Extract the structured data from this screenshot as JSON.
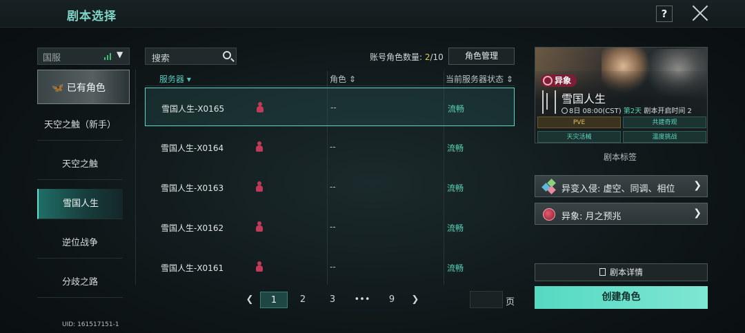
{
  "header": {
    "title": "剧本选择",
    "help_label": "?"
  },
  "sidebar": {
    "region": "国服",
    "owned_label": "已有角色",
    "items": [
      {
        "label": "天空之触（新手）"
      },
      {
        "label": "天空之触"
      },
      {
        "label": "雪国人生"
      },
      {
        "label": "逆位战争"
      },
      {
        "label": "分歧之路"
      }
    ],
    "active_index": 2,
    "uid": "UID: 161517151-1"
  },
  "search": {
    "placeholder": "搜索"
  },
  "account": {
    "label": "账号角色数量: ",
    "current": "2",
    "max": "/10",
    "manage_button": "角色管理"
  },
  "table": {
    "headers": {
      "server": "服务器 ▾",
      "role": "角色 ⇕",
      "status": "当前服务器状态 ⇕"
    },
    "rows": [
      {
        "server": "雪国人生-X0165",
        "role": "--",
        "status": "流畅"
      },
      {
        "server": "雪国人生-X0164",
        "role": "--",
        "status": "流畅"
      },
      {
        "server": "雪国人生-X0163",
        "role": "--",
        "status": "流畅"
      },
      {
        "server": "雪国人生-X0162",
        "role": "--",
        "status": "流畅"
      },
      {
        "server": "雪国人生-X0161",
        "role": "--",
        "status": "流畅"
      }
    ],
    "selected_index": 0
  },
  "pagination": {
    "prev": "❮",
    "pages": [
      "1",
      "2",
      "3",
      "•••",
      "9"
    ],
    "next": "❯",
    "active": "1",
    "page_suffix": "页"
  },
  "scenario": {
    "badge": "异象",
    "name": "雪国人生",
    "time": "8日 08:00(CST)",
    "day": "第2天",
    "open_text": "剧本开启时间 2",
    "tags": [
      "PVE",
      "共建奇观",
      "天灾活械",
      "温度挑战"
    ],
    "tags_title": "剧本标签",
    "links": [
      {
        "label": "异变入侵: 虚空、同调、相位"
      },
      {
        "label": "异象: 月之预兆"
      }
    ],
    "details_button": "剧本详情",
    "create_button": "创建角色"
  },
  "colors": {
    "accent": "#57d2b6",
    "primary_button": "#6fe0cc",
    "badge": "#7c1f36"
  }
}
